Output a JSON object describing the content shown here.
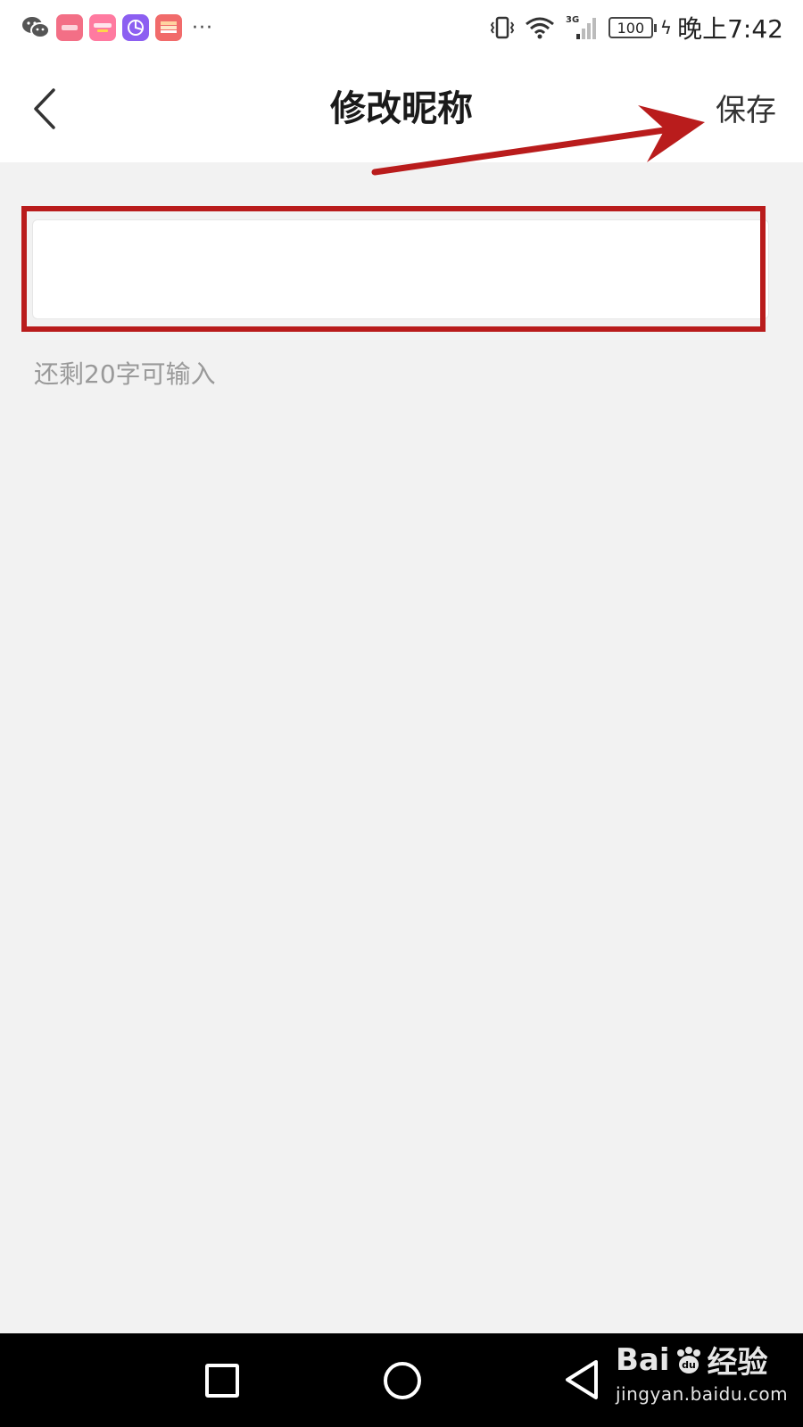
{
  "status_bar": {
    "app_icons": [
      "wechat-icon",
      "app-icon-1",
      "app-icon-2",
      "app-icon-3",
      "app-icon-4"
    ],
    "overflow": "···",
    "network": "3G",
    "battery": "100",
    "time": "晚上7:42"
  },
  "header": {
    "title": "修改昵称",
    "save_label": "保存"
  },
  "nickname": {
    "value": "",
    "hint": "还剩20字可输入"
  },
  "annotation": {
    "color": "#b91c1c"
  },
  "watermark": {
    "logo_left": "Bai",
    "logo_right": "经验",
    "logo_du": "du",
    "url": "jingyan.baidu.com"
  }
}
